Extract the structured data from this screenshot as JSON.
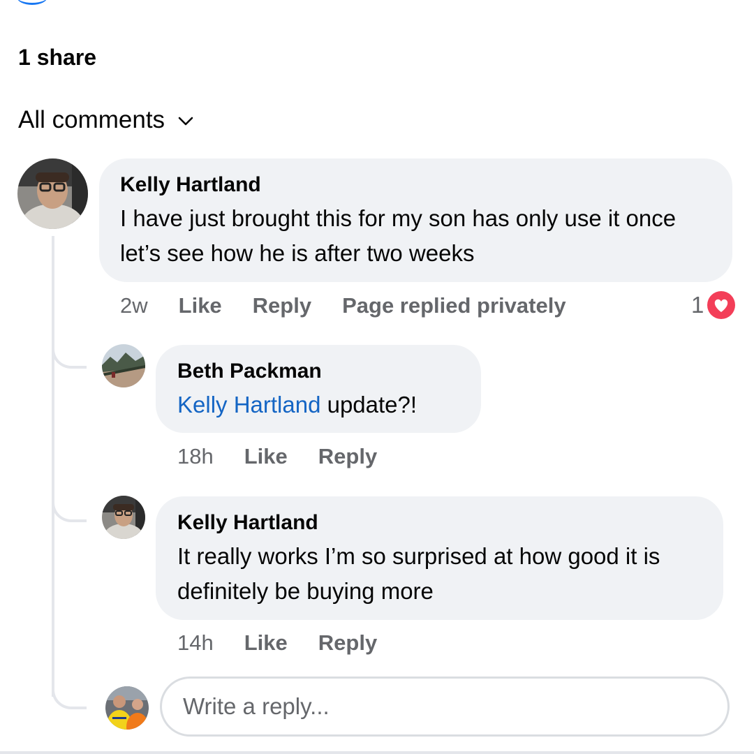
{
  "post": {
    "shares_label": "1 share",
    "filter_label": "All comments"
  },
  "comments": [
    {
      "author": "Kelly Hartland",
      "text": "I have just brought this for my son has only use it once let’s see how he is after two weeks",
      "time": "2w",
      "like_label": "Like",
      "reply_label": "Reply",
      "page_reply_label": "Page replied privately",
      "reaction_count": "1"
    },
    {
      "author": "Beth Packman",
      "mention": "Kelly Hartland",
      "text": " update?!",
      "time": "18h",
      "like_label": "Like",
      "reply_label": "Reply"
    },
    {
      "author": "Kelly Hartland",
      "text": "It really works I’m so surprised at how good it is definitely be buying more",
      "time": "14h",
      "like_label": "Like",
      "reply_label": "Reply"
    }
  ],
  "reply_input": {
    "placeholder": "Write a reply..."
  },
  "colors": {
    "bubble": "#f0f2f5",
    "meta_text": "#65676b",
    "mention": "#1465c4",
    "love_reaction": "#f33e58",
    "thread_line": "#e4e6eb"
  },
  "icons": [
    "chevron-down-icon",
    "love-reaction-icon"
  ]
}
